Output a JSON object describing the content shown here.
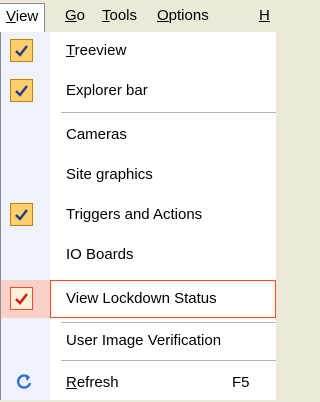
{
  "menubar": {
    "items": [
      {
        "first": "V",
        "rest": "iew",
        "active": true
      },
      {
        "first": "G",
        "rest": "o"
      },
      {
        "first": "T",
        "rest": "ools"
      },
      {
        "first": "O",
        "rest": "ptions"
      },
      {
        "first": "H",
        "rest": ""
      }
    ]
  },
  "menu": {
    "items": [
      {
        "first": "T",
        "rest": "reeview",
        "checked": true
      },
      {
        "label": "Explorer bar",
        "checked": true
      },
      {
        "label": "Cameras",
        "checked": false
      },
      {
        "label": "Site graphics",
        "checked": false
      },
      {
        "label": "Triggers and Actions",
        "checked": true
      },
      {
        "label": "IO Boards",
        "checked": false
      },
      {
        "label": "View Lockdown Status",
        "checked": true,
        "highlighted": true
      },
      {
        "label": "User Image Verification",
        "checked": false
      },
      {
        "first": "R",
        "rest": "efresh",
        "shortcut": "F5",
        "icon": "refresh-icon"
      }
    ]
  },
  "colors": {
    "check_bg": "#ffcf6b",
    "check_mark": "#1e3c8c",
    "highlight_border": "#ff4b1e",
    "highlight_check": "#d21e1e"
  }
}
